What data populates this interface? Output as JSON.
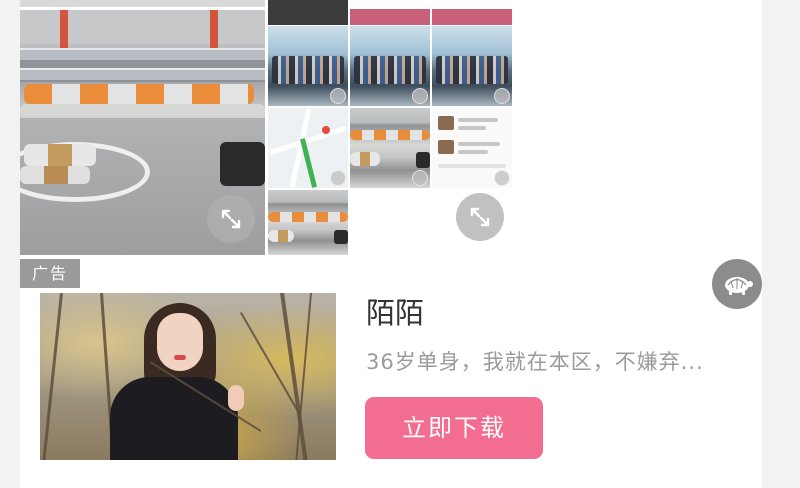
{
  "ad": {
    "tag_label": "广告",
    "title": "陌陌",
    "description": "36岁单身，我就在本区，不嫌弃...",
    "cta_label": "立即下载"
  },
  "icons": {
    "expand": "expand-arrows-icon",
    "close_badge": "turtle-logo-icon"
  },
  "colors": {
    "cta_background": "#f26d8f",
    "ad_tag_background": "#9a9a9a",
    "badge_background": "#8c8c8c"
  }
}
